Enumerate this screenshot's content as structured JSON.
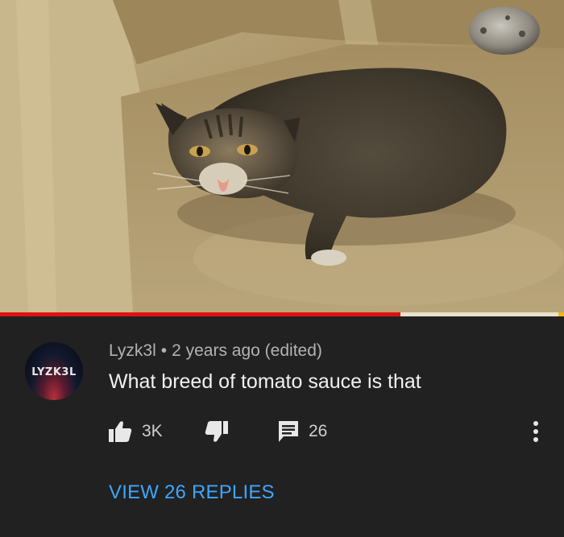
{
  "video": {
    "progress_played_fraction": 0.71,
    "progress_buffered_fraction": 0.99,
    "colors": {
      "played": "#e0120f",
      "buffered": "#e8e1cf",
      "marker": "#f2b51a"
    }
  },
  "comment": {
    "avatar_text": "LYZK3L",
    "author": "Lyzk3l",
    "separator": "•",
    "time": "2 years ago (edited)",
    "text": "What breed of tomato sauce is that",
    "likes": "3K",
    "reply_count": "26",
    "view_replies_label": "VIEW 26 REPLIES"
  },
  "icons": [
    "thumbs-up-icon",
    "thumbs-down-icon",
    "comment-icon",
    "more-vert-icon"
  ],
  "theme": {
    "background": "#212121",
    "link": "#3ea6ff"
  }
}
